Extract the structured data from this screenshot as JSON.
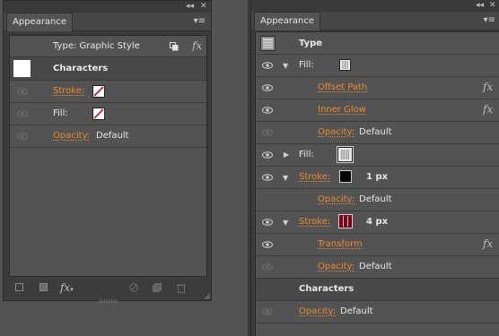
{
  "left_panel": {
    "tab_label": "Appearance",
    "collapse_glyph": "◂◂",
    "close_glyph": "✕",
    "menu_glyph": "▾≡",
    "type_label": "Type: Graphic Style",
    "fx_label": "fx",
    "characters_label": "Characters",
    "rows": [
      {
        "label": "Stroke:",
        "swatch": "none"
      },
      {
        "label": "Fill:",
        "swatch": "none"
      },
      {
        "label": "Opacity:",
        "value": "Default"
      }
    ],
    "bottom_fx": "fx"
  },
  "right_panel": {
    "tab_label": "Appearance",
    "collapse_glyph": "◂◂",
    "close_glyph": "✕",
    "menu_glyph": "▾≡",
    "type_label": "Type",
    "rows": [
      {
        "kind": "fill",
        "label": "Fill:",
        "expanded": true
      },
      {
        "kind": "effect",
        "label": "Offset Path",
        "fx": "fx"
      },
      {
        "kind": "effect",
        "label": "Inner Glow",
        "fx": "fx"
      },
      {
        "kind": "opacity",
        "label": "Opacity:",
        "value": "Default"
      },
      {
        "kind": "fill",
        "label": "Fill:",
        "expanded": false
      },
      {
        "kind": "stroke",
        "label": "Stroke:",
        "weight": "1 px"
      },
      {
        "kind": "opacity",
        "label": "Opacity:",
        "value": "Default"
      },
      {
        "kind": "stroke",
        "label": "Stroke:",
        "weight": "4 px"
      },
      {
        "kind": "effect",
        "label": "Transform",
        "fx": "fx"
      },
      {
        "kind": "opacity",
        "label": "Opacity:",
        "value": "Default"
      },
      {
        "kind": "heading",
        "label": "Characters"
      },
      {
        "kind": "opacity",
        "label": "Opacity:",
        "value": "Default"
      }
    ]
  },
  "colors": {
    "accent_orange": "#ec8a2c",
    "panel_bg": "#535353",
    "stroke_red": "#c8102e"
  }
}
